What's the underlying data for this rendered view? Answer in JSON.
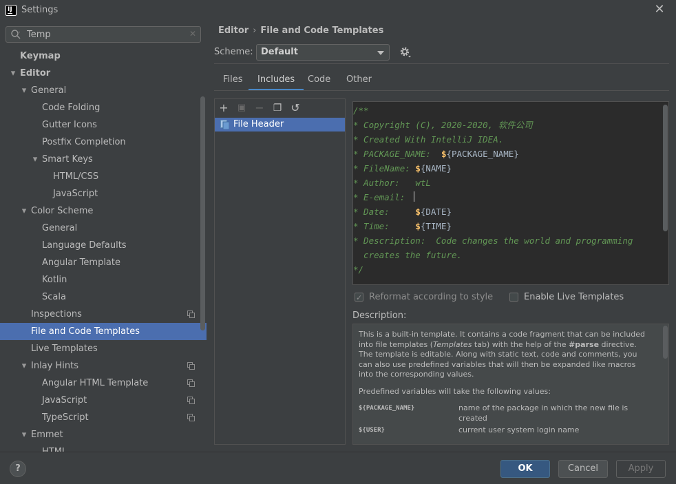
{
  "window": {
    "title": "Settings",
    "close_glyph": "✕"
  },
  "search": {
    "value": "Temp",
    "clear_glyph": "✕"
  },
  "sidebar": {
    "items": [
      {
        "label": "Keymap",
        "level": 0,
        "bold": true,
        "expander": ""
      },
      {
        "label": "Editor",
        "level": 0,
        "bold": true,
        "expander": "expanded"
      },
      {
        "label": "General",
        "level": 1,
        "expander": "expanded"
      },
      {
        "label": "Code Folding",
        "level": 2,
        "expander": ""
      },
      {
        "label": "Gutter Icons",
        "level": 2,
        "expander": ""
      },
      {
        "label": "Postfix Completion",
        "level": 2,
        "expander": ""
      },
      {
        "label": "Smart Keys",
        "level": 2,
        "expander": "expanded"
      },
      {
        "label": "HTML/CSS",
        "level": 3,
        "expander": ""
      },
      {
        "label": "JavaScript",
        "level": 3,
        "expander": ""
      },
      {
        "label": "Color Scheme",
        "level": 1,
        "expander": "expanded"
      },
      {
        "label": "General",
        "level": 2,
        "expander": ""
      },
      {
        "label": "Language Defaults",
        "level": 2,
        "expander": ""
      },
      {
        "label": "Angular Template",
        "level": 2,
        "expander": ""
      },
      {
        "label": "Kotlin",
        "level": 2,
        "expander": ""
      },
      {
        "label": "Scala",
        "level": 2,
        "expander": ""
      },
      {
        "label": "Inspections",
        "level": 1,
        "expander": "",
        "icon": "copy-icon"
      },
      {
        "label": "File and Code Templates",
        "level": 1,
        "expander": "",
        "selected": true
      },
      {
        "label": "Live Templates",
        "level": 1,
        "expander": ""
      },
      {
        "label": "Inlay Hints",
        "level": 1,
        "expander": "expanded",
        "icon": "copy-icon"
      },
      {
        "label": "Angular HTML Template",
        "level": 2,
        "expander": "",
        "icon": "copy-icon"
      },
      {
        "label": "JavaScript",
        "level": 2,
        "expander": "",
        "icon": "copy-icon"
      },
      {
        "label": "TypeScript",
        "level": 2,
        "expander": "",
        "icon": "copy-icon"
      },
      {
        "label": "Emmet",
        "level": 1,
        "expander": "expanded"
      },
      {
        "label": "HTML",
        "level": 2,
        "expander": ""
      }
    ]
  },
  "breadcrumb": {
    "parent": "Editor",
    "separator": "›",
    "current": "File and Code Templates"
  },
  "scheme": {
    "label": "Scheme:",
    "value": "Default"
  },
  "tabs": [
    {
      "label": "Files",
      "active": false
    },
    {
      "label": "Includes",
      "active": true
    },
    {
      "label": "Code",
      "active": false
    },
    {
      "label": "Other",
      "active": false
    }
  ],
  "templates": {
    "toolbar": {
      "add": "+",
      "copy_disabled": "▣",
      "remove": "−",
      "duplicate": "❐",
      "reset": "↺"
    },
    "items": [
      {
        "label": "File Header"
      }
    ]
  },
  "editor": {
    "lines": [
      {
        "comment": "/**",
        "text": ""
      },
      {
        "comment": "* Copyright (C), 2020-2020, 软件公司",
        "text": ""
      },
      {
        "comment": "* Created With IntelliJ IDEA.",
        "text": ""
      },
      {
        "comment": "* PACKAGE_NAME:  ",
        "dollar": "$",
        "text": "{PACKAGE_NAME}"
      },
      {
        "comment": "* FileName: ",
        "dollar": "$",
        "text": "{NAME}"
      },
      {
        "comment": "* Author:   wtL",
        "text": ""
      },
      {
        "comment": "* E-email: ",
        "text": ""
      },
      {
        "comment": "* Date:     ",
        "dollar": "$",
        "text": "{DATE}"
      },
      {
        "comment": "* Time:     ",
        "dollar": "$",
        "text": "{TIME}"
      },
      {
        "comment": "* Description:  Code changes the world and programming",
        "text": ""
      },
      {
        "comment": "  creates the future.",
        "text": ""
      },
      {
        "comment": "*/",
        "text": ""
      }
    ]
  },
  "options": {
    "reformat": {
      "label": "Reformat according to style",
      "checked": true,
      "enabled": false
    },
    "live_templates": {
      "label": "Enable Live Templates",
      "checked": false,
      "enabled": true
    }
  },
  "description": {
    "label": "Description:",
    "p1a": "This is a built-in template. It contains a code fragment that can be included into file templates (",
    "p1b": "Templates",
    "p1c": " tab) with the help of the ",
    "p1d": "#parse",
    "p1e": " directive.",
    "p2": "The template is editable. Along with static text, code and comments, you can also use predefined variables that will then be expanded like macros into the corresponding values.",
    "p3": "Predefined variables will take the following values:",
    "vars": [
      {
        "name": "${PACKAGE_NAME}",
        "desc": "name of the package in which the new file is created"
      },
      {
        "name": "${USER}",
        "desc": "current user system login name"
      }
    ]
  },
  "buttons": {
    "help": "?",
    "ok": "OK",
    "cancel": "Cancel",
    "apply": "Apply"
  }
}
